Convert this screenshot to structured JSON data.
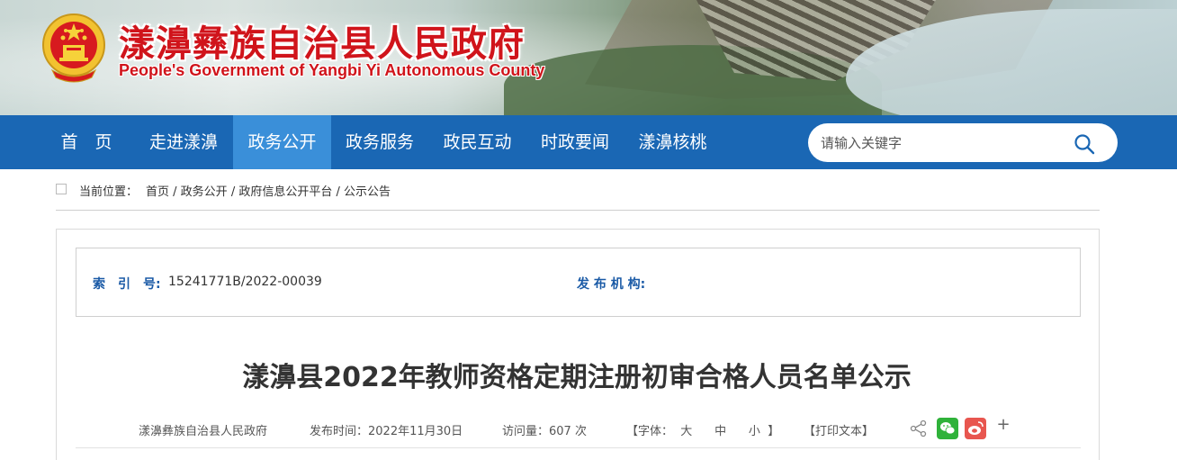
{
  "header": {
    "title": "漾濞彝族自治县人民政府",
    "subtitle": "People's Government of Yangbi Yi Autonomous County"
  },
  "nav": {
    "items": [
      {
        "label": "首　页",
        "active": false
      },
      {
        "label": "走进漾濞",
        "active": false
      },
      {
        "label": "政务公开",
        "active": true
      },
      {
        "label": "政务服务",
        "active": false
      },
      {
        "label": "政民互动",
        "active": false
      },
      {
        "label": "时政要闻",
        "active": false
      },
      {
        "label": "漾濞核桃",
        "active": false
      }
    ],
    "search_placeholder": "请输入关键字"
  },
  "breadcrumb": {
    "label": "当前位置：",
    "items": [
      "首页",
      "政务公开",
      "政府信息公开平台",
      "公示公告"
    ],
    "separator": " / "
  },
  "meta": {
    "index_label": "索　引　号:",
    "index_value": "15241771B/2022-00039",
    "publisher_label": "发 布 机 构:",
    "publisher_value": ""
  },
  "article": {
    "title": "漾濞县2022年教师资格定期注册初审合格人员名单公示",
    "source": "漾濞彝族自治县人民政府",
    "publish_time": "发布时间：2022年11月30日",
    "views": "访问量：607 次",
    "font_label": "【字体：",
    "font_large": "大",
    "font_medium": "中",
    "font_small": "小",
    "font_close": "】",
    "print": "【打印文本】",
    "share_icon": "share-icon",
    "more_icon": "+"
  },
  "colors": {
    "nav_bg": "#1a67b4",
    "nav_active": "#3a8fd9",
    "title_red": "#d0141b",
    "label_blue": "#1a5aa6"
  }
}
